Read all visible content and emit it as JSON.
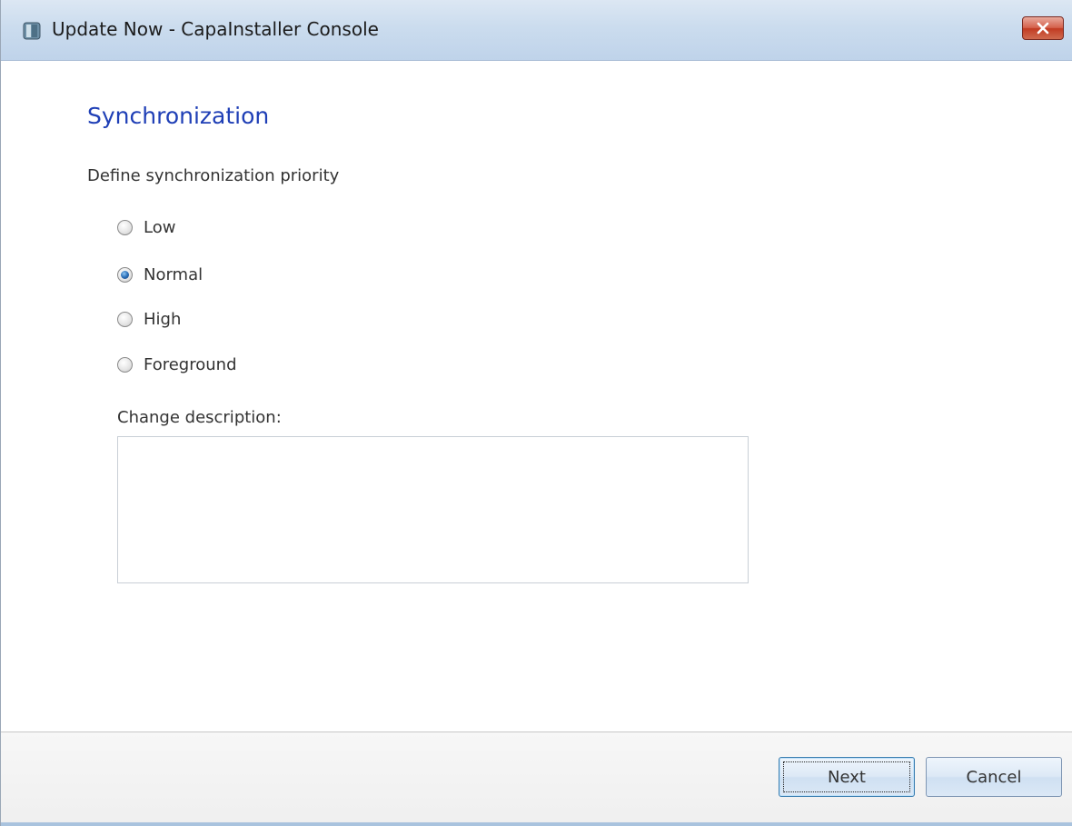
{
  "window": {
    "title": "Update Now - CapaInstaller Console",
    "app_icon": "capainstaller-app-icon",
    "close_icon": "close-icon"
  },
  "page": {
    "title": "Synchronization",
    "instruction": "Define synchronization priority"
  },
  "priority_options": [
    {
      "label": "Low",
      "checked": false
    },
    {
      "label": "Normal",
      "checked": true
    },
    {
      "label": "High",
      "checked": false
    },
    {
      "label": "Foreground",
      "checked": false
    }
  ],
  "description": {
    "label": "Change description:",
    "value": ""
  },
  "footer": {
    "next_label": "Next",
    "cancel_label": "Cancel"
  },
  "colors": {
    "title_blue": "#1f3fb6",
    "titlebar": "#cbdcee",
    "close_red": "#c23b22"
  }
}
